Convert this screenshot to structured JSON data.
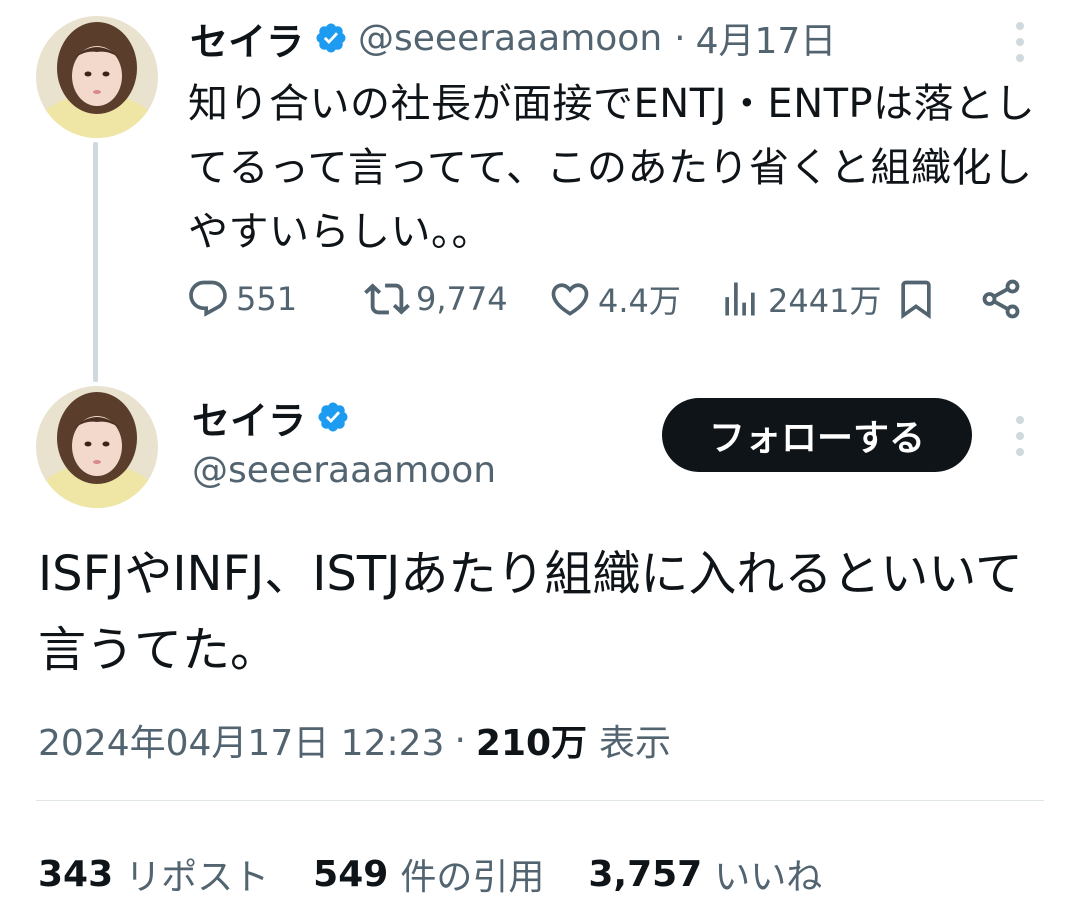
{
  "colors": {
    "text_primary": "#0f1419",
    "text_secondary": "#536471",
    "verified_blue": "#1d9bf0",
    "follow_button_bg": "#0f1419",
    "thread_line": "#cfd9de"
  },
  "parent_tweet": {
    "author_name": "セイラ",
    "handle": "@seeeraaamoon",
    "separator": "·",
    "date": "4月17日",
    "text": "知り合いの社長が面接でENTJ・ENTPは落としてるって言ってて、このあたり省くと組織化しやすいらしい。。",
    "actions": {
      "reply_icon": "reply-icon",
      "reply_count": "551",
      "retweet_icon": "retweet-icon",
      "retweet_count": "9,774",
      "like_icon": "heart-icon",
      "like_count": "4.4万",
      "views_icon": "views-chart-icon",
      "views_count": "2441万",
      "bookmark_icon": "bookmark-icon",
      "share_icon": "share-icon"
    }
  },
  "main_tweet": {
    "author_name": "セイラ",
    "handle": "@seeeraaamoon",
    "follow_label": "フォローする",
    "text": "ISFJやINFJ、ISTJあたり組織に入れるといいて言うてた。",
    "timestamp": "2024年04月17日 12:23",
    "separator": "·",
    "views_count": "210万",
    "views_label": "表示",
    "stats": {
      "reposts_count": "343",
      "reposts_label": "リポスト",
      "quotes_count": "549",
      "quotes_label": "件の引用",
      "likes_count": "3,757",
      "likes_label": "いいね"
    }
  }
}
